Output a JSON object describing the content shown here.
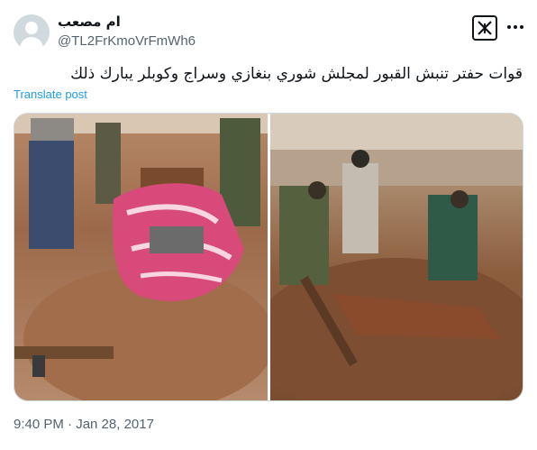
{
  "author": {
    "display_name": "ام مصعب",
    "handle": "@TL2FrKmoVrFmWh6",
    "avatar_icon": "default-avatar-icon"
  },
  "header": {
    "logo_icon": "x-logo-icon",
    "more_icon": "more-options-icon"
  },
  "tweet": {
    "text": "قوات حفتر تنبش القبور لمجلش شوري بنغازي وسراج وكوبلر يبارك ذلك",
    "translate_label": "Translate post",
    "timestamp": "9:40 PM · Jan 28, 2017"
  },
  "media": {
    "images": [
      {
        "subject": "people at an opened grave with a body wrapped in a pink floral blanket, rifle on the ground"
      },
      {
        "subject": "men in fatigues digging graves among rubble"
      }
    ]
  },
  "colors": {
    "link": "#1d9bf0",
    "secondary_text": "#536471",
    "primary_text": "#0f1419",
    "border": "#cfd9de"
  }
}
